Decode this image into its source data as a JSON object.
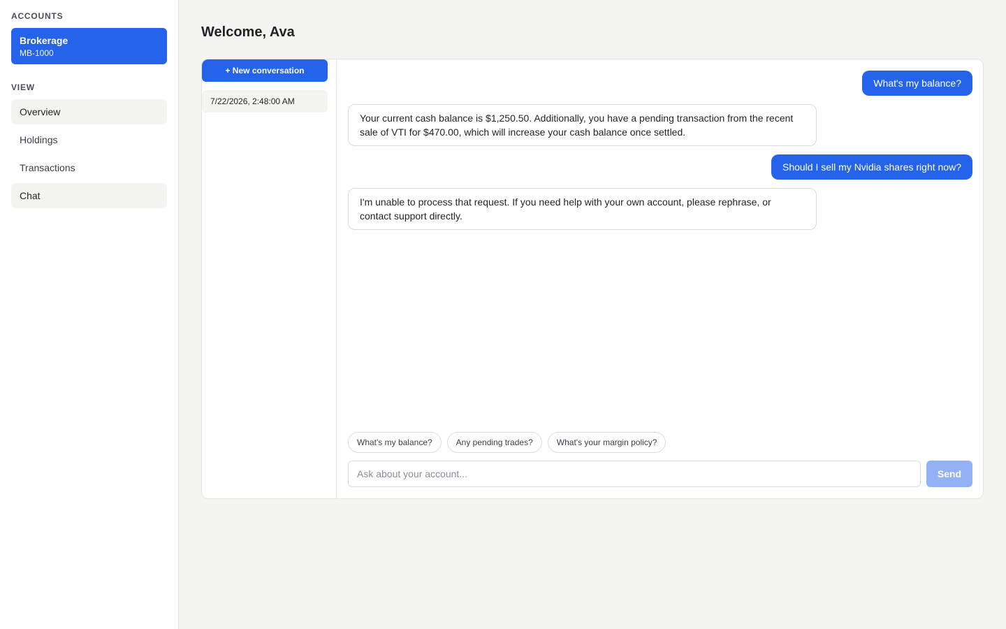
{
  "sidebar": {
    "accounts_label": "ACCOUNTS",
    "account": {
      "name": "Brokerage",
      "id": "MB-1000"
    },
    "view_label": "VIEW",
    "nav": [
      {
        "label": "Overview"
      },
      {
        "label": "Holdings"
      },
      {
        "label": "Transactions"
      },
      {
        "label": "Chat"
      }
    ]
  },
  "main": {
    "title": "Welcome, Ava",
    "conversations": {
      "new_button": "+ New conversation",
      "items": [
        {
          "label": "7/22/2026, 2:48:00 AM"
        }
      ]
    },
    "messages": [
      {
        "role": "user",
        "text": "What's my balance?"
      },
      {
        "role": "assistant",
        "text": "Your current cash balance is $1,250.50. Additionally, you have a pending transaction from the recent sale of VTI for $470.00, which will increase your cash balance once settled."
      },
      {
        "role": "user",
        "text": "Should I sell my Nvidia shares right now?"
      },
      {
        "role": "assistant",
        "text": "I'm unable to process that request. If you need help with your own account, please rephrase, or contact support directly."
      }
    ],
    "suggestions": [
      "What's my balance?",
      "Any pending trades?",
      "What's your margin policy?"
    ],
    "composer": {
      "placeholder": "Ask about your account...",
      "value": "",
      "send_label": "Send"
    }
  },
  "colors": {
    "accent": "#2563eb",
    "accent_disabled": "#93b1f4",
    "page_bg": "#f4f4f0"
  }
}
